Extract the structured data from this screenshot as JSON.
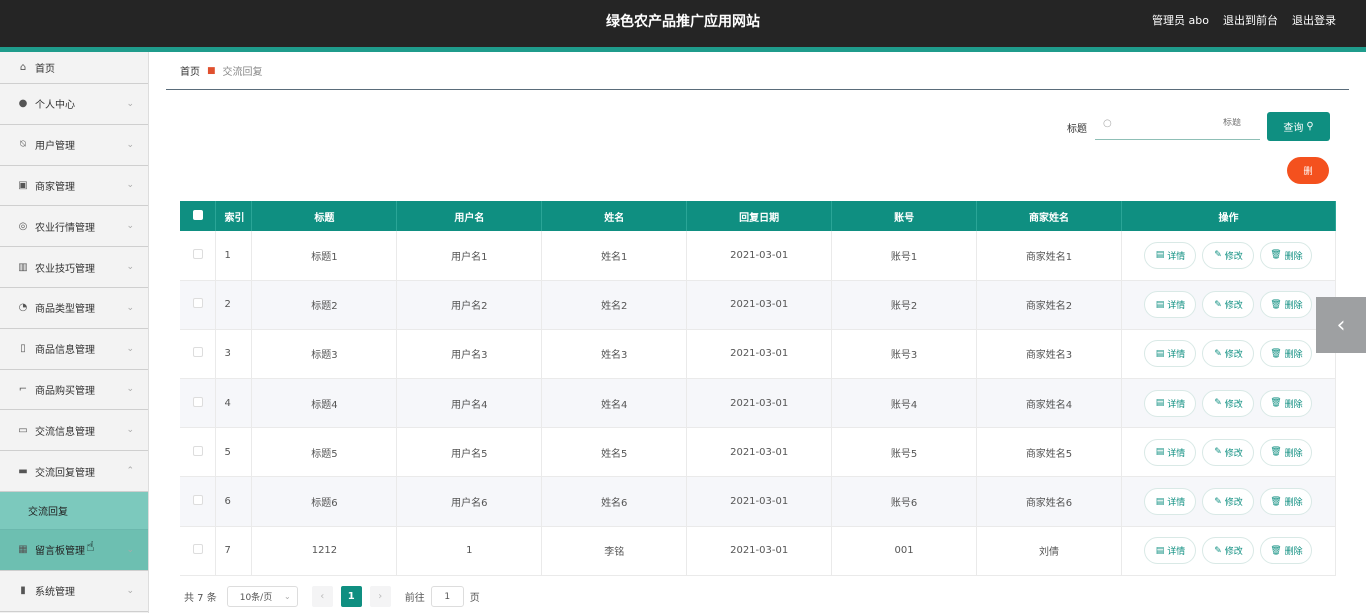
{
  "header": {
    "title": "绿色农产品推广应用网站",
    "user": "管理员 abo",
    "front": "退出到前台",
    "logout": "退出登录"
  },
  "sidebar": {
    "items": [
      {
        "label": "首页",
        "icon": "home-icon"
      },
      {
        "label": "个人中心",
        "icon": "user-icon"
      },
      {
        "label": "用户管理",
        "icon": "bell-off-icon"
      },
      {
        "label": "商家管理",
        "icon": "clipboard-icon"
      },
      {
        "label": "农业行情管理",
        "icon": "compass-icon"
      },
      {
        "label": "农业技巧管理",
        "icon": "library-icon"
      },
      {
        "label": "商品类型管理",
        "icon": "gauge-icon"
      },
      {
        "label": "商品信息管理",
        "icon": "mic-icon"
      },
      {
        "label": "商品购买管理",
        "icon": "crop-icon"
      },
      {
        "label": "交流信息管理",
        "icon": "chat-icon"
      },
      {
        "label": "交流回复管理",
        "icon": "monitor-icon"
      },
      {
        "label": "留言板管理",
        "icon": "grid-icon"
      },
      {
        "label": "系统管理",
        "icon": "bar-chart-icon"
      }
    ],
    "submenu_active": "交流回复"
  },
  "breadcrumb": {
    "home": "首页",
    "current": "交流回复"
  },
  "search": {
    "label": "标题",
    "placeholder": "标题",
    "button": "查询"
  },
  "delete_button": "删",
  "table": {
    "headers": [
      "索引",
      "标题",
      "用户名",
      "姓名",
      "回复日期",
      "账号",
      "商家姓名",
      "操作"
    ],
    "rows": [
      {
        "idx": "1",
        "title": "标题1",
        "username": "用户名1",
        "name": "姓名1",
        "date": "2021-03-01",
        "account": "账号1",
        "merchant": "商家姓名1"
      },
      {
        "idx": "2",
        "title": "标题2",
        "username": "用户名2",
        "name": "姓名2",
        "date": "2021-03-01",
        "account": "账号2",
        "merchant": "商家姓名2"
      },
      {
        "idx": "3",
        "title": "标题3",
        "username": "用户名3",
        "name": "姓名3",
        "date": "2021-03-01",
        "account": "账号3",
        "merchant": "商家姓名3"
      },
      {
        "idx": "4",
        "title": "标题4",
        "username": "用户名4",
        "name": "姓名4",
        "date": "2021-03-01",
        "account": "账号4",
        "merchant": "商家姓名4"
      },
      {
        "idx": "5",
        "title": "标题5",
        "username": "用户名5",
        "name": "姓名5",
        "date": "2021-03-01",
        "account": "账号5",
        "merchant": "商家姓名5"
      },
      {
        "idx": "6",
        "title": "标题6",
        "username": "用户名6",
        "name": "姓名6",
        "date": "2021-03-01",
        "account": "账号6",
        "merchant": "商家姓名6"
      },
      {
        "idx": "7",
        "title": "1212",
        "username": "1",
        "name": "李铭",
        "date": "2021-03-01",
        "account": "001",
        "merchant": "刘倩"
      }
    ],
    "ops": {
      "detail": "详情",
      "edit": "修改",
      "delete": "删除"
    }
  },
  "pager": {
    "total": "共 7 条",
    "page_size": "10条/页",
    "current": "1",
    "goto": "前往",
    "goto_value": "1",
    "page_unit": "页"
  },
  "colors": {
    "accent": "#0f8f81",
    "danger": "#f4511e",
    "topbar": "#252525"
  }
}
